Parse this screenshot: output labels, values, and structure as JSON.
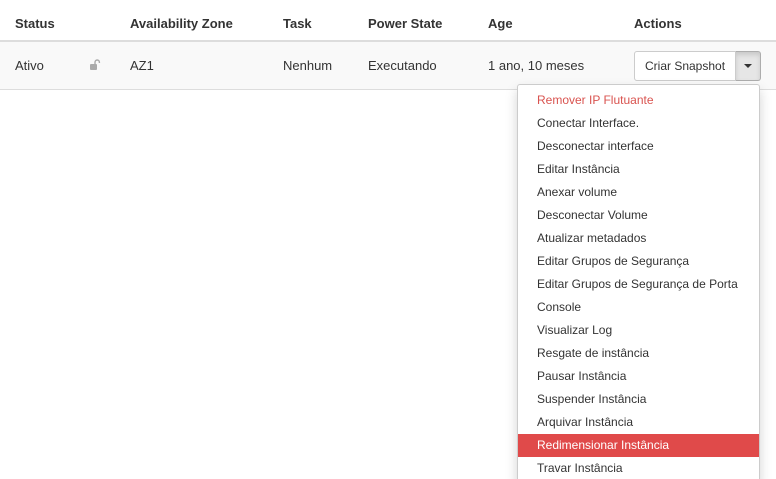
{
  "table": {
    "headers": {
      "status": "Status",
      "availability_zone": "Availability Zone",
      "task": "Task",
      "power_state": "Power State",
      "age": "Age",
      "actions": "Actions"
    },
    "row": {
      "status": "Ativo",
      "lock_icon": "unlocked-padlock-icon",
      "availability_zone": "AZ1",
      "task": "Nenhum",
      "power_state": "Executando",
      "age": "1 ano, 10 meses",
      "action_button": "Criar Snapshot",
      "toggle_icon": "caret-down-icon"
    }
  },
  "menu": {
    "items": [
      {
        "label": "Remover IP Flutuante",
        "style": "danger"
      },
      {
        "label": "Conectar Interface.",
        "style": "normal"
      },
      {
        "label": "Desconectar interface",
        "style": "normal"
      },
      {
        "label": "Editar Instância",
        "style": "normal"
      },
      {
        "label": "Anexar volume",
        "style": "normal"
      },
      {
        "label": "Desconectar Volume",
        "style": "normal"
      },
      {
        "label": "Atualizar metadados",
        "style": "normal"
      },
      {
        "label": "Editar Grupos de Segurança",
        "style": "normal"
      },
      {
        "label": "Editar Grupos de Segurança de Porta",
        "style": "normal"
      },
      {
        "label": "Console",
        "style": "normal"
      },
      {
        "label": "Visualizar Log",
        "style": "normal"
      },
      {
        "label": "Resgate de instância",
        "style": "normal"
      },
      {
        "label": "Pausar Instância",
        "style": "normal"
      },
      {
        "label": "Suspender Instância",
        "style": "normal"
      },
      {
        "label": "Arquivar Instância",
        "style": "normal"
      },
      {
        "label": "Redimensionar Instância",
        "style": "active"
      },
      {
        "label": "Travar Instância",
        "style": "normal"
      }
    ]
  },
  "colors": {
    "danger_text": "#d9534f",
    "active_background": "#e04a4a",
    "row_background": "#f9f9f9"
  }
}
